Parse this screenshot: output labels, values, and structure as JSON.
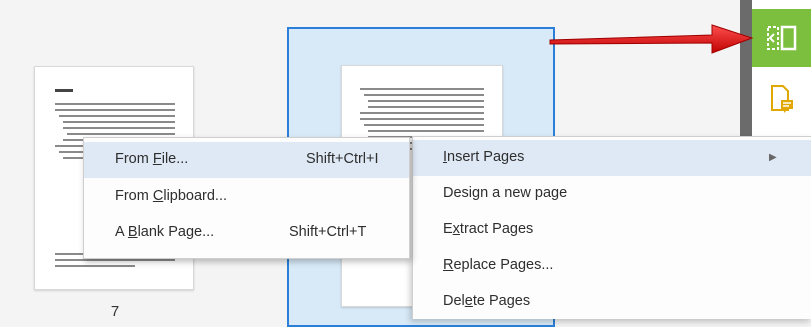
{
  "thumbnails": {
    "page_number": "7"
  },
  "submenu": {
    "items": [
      {
        "label_pre": "From ",
        "label_u": "F",
        "label_post": "ile...",
        "shortcut": "Shift+Ctrl+I"
      },
      {
        "label_pre": "From ",
        "label_u": "C",
        "label_post": "lipboard...",
        "shortcut": ""
      },
      {
        "label_pre": "A ",
        "label_u": "B",
        "label_post": "lank Page...",
        "shortcut": "Shift+Ctrl+T"
      }
    ]
  },
  "context_menu": {
    "items": [
      {
        "label_pre": "",
        "label_u": "I",
        "label_post": "nsert Pages",
        "has_submenu": true
      },
      {
        "label_pre": "Design a new page",
        "label_u": "",
        "label_post": "",
        "has_submenu": false
      },
      {
        "label_pre": "E",
        "label_u": "x",
        "label_post": "tract Pages",
        "has_submenu": false
      },
      {
        "label_pre": "",
        "label_u": "R",
        "label_post": "eplace Pages...",
        "has_submenu": false
      },
      {
        "label_pre": "Del",
        "label_u": "e",
        "label_post": "te Pages",
        "has_submenu": false
      }
    ]
  },
  "toolbar": {
    "buttons": [
      {
        "icon": "page-thumbnails-icon",
        "active": true
      },
      {
        "icon": "page-comment-icon",
        "active": false
      }
    ]
  },
  "colors": {
    "selection_border": "#2b7fd8",
    "active_tool": "#7cbf3e",
    "arrow": "#e02020",
    "menu_highlight": "#dfe9f5"
  }
}
